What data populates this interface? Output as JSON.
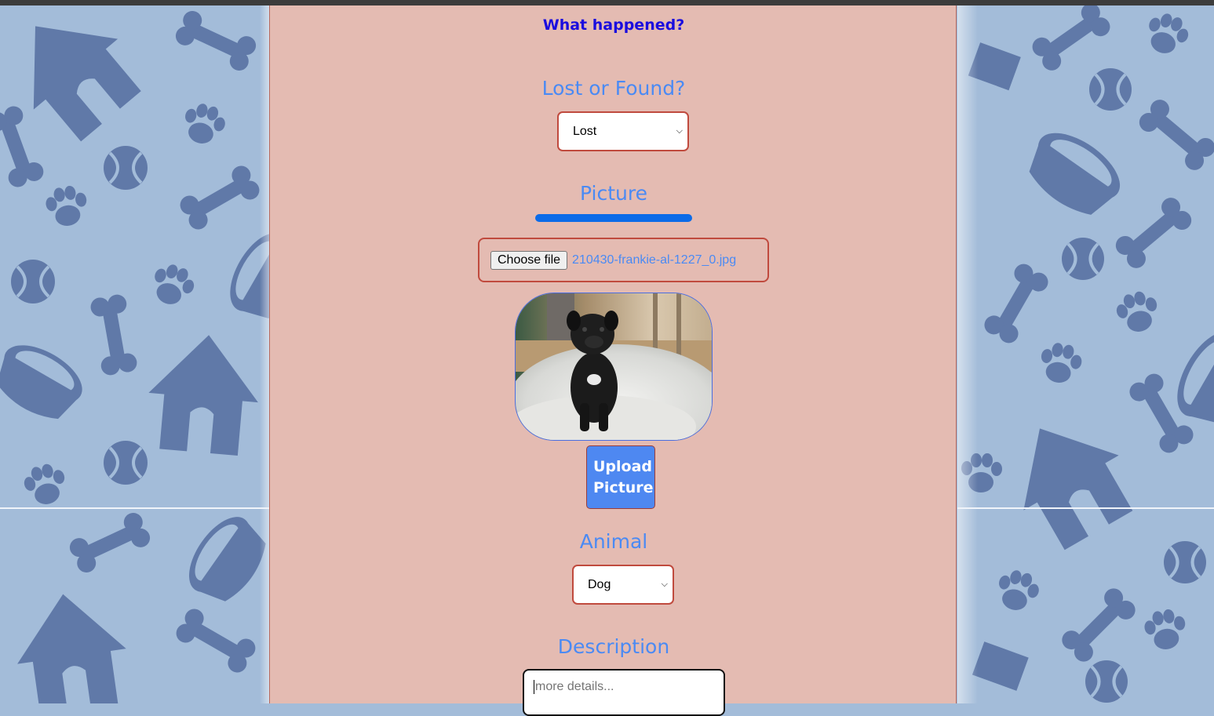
{
  "form": {
    "heading": "What happened?",
    "lost_found": {
      "title": "Lost or Found?",
      "selected": "Lost"
    },
    "picture": {
      "title": "Picture",
      "upload_progress": 1.0,
      "choose_file_label": "Choose file",
      "file_name": "210430-frankie-al-1227_0.jpg",
      "preview_alt": "photo of a small black pug puppy on a fluffy bed",
      "upload_button": "Upload Picture"
    },
    "animal": {
      "title": "Animal",
      "selected": "Dog"
    },
    "description": {
      "title": "Description",
      "placeholder": "more details..."
    }
  },
  "colors": {
    "panel_bg": "#e4bbb2",
    "accent_blue": "#4a8af4",
    "heading_link": "#1a0dde",
    "select_border": "#c04a3e",
    "wallpaper_bg": "#a3bcd9",
    "wallpaper_shapes": "#6079a8"
  },
  "icons": {
    "select_chevron": "chevron-down-icon",
    "wallpaper": [
      "dog-house-icon",
      "bone-icon",
      "paw-print-icon",
      "tennis-ball-icon",
      "pet-bowl-icon"
    ]
  }
}
